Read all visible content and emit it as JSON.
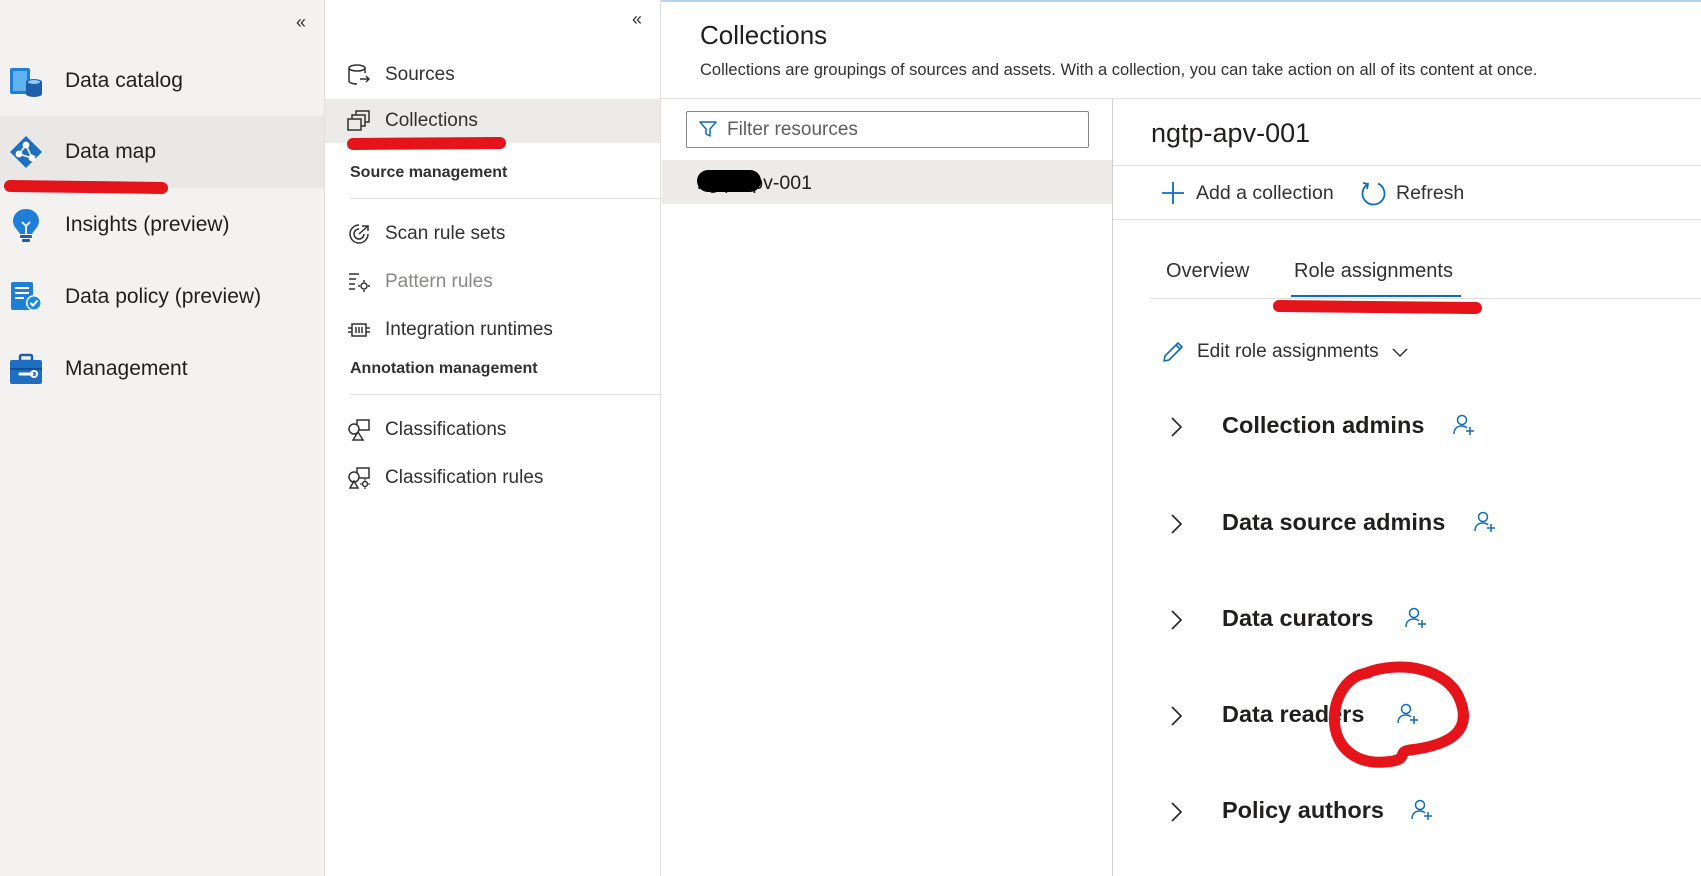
{
  "left_nav": {
    "collapse_glyph": "«",
    "items": [
      {
        "label": "Data catalog",
        "icon": "data-catalog-icon"
      },
      {
        "label": "Data map",
        "icon": "data-map-icon"
      },
      {
        "label": "Insights (preview)",
        "icon": "insights-bulb-icon"
      },
      {
        "label": "Data policy (preview)",
        "icon": "data-policy-icon"
      },
      {
        "label": "Management",
        "icon": "toolbox-icon"
      }
    ],
    "active_index": 1
  },
  "sub_nav": {
    "collapse_glyph": "«",
    "items": [
      {
        "label": "Sources",
        "icon": "sources-icon"
      },
      {
        "label": "Collections",
        "icon": "collections-icon"
      }
    ],
    "source_management": {
      "header": "Source management",
      "items": [
        {
          "label": "Scan rule sets",
          "icon": "scan-rule-sets-icon"
        },
        {
          "label": "Pattern rules",
          "icon": "pattern-rules-icon"
        },
        {
          "label": "Integration runtimes",
          "icon": "integration-runtimes-icon"
        }
      ]
    },
    "annotation_management": {
      "header": "Annotation management",
      "items": [
        {
          "label": "Classifications",
          "icon": "classifications-icon"
        },
        {
          "label": "Classification rules",
          "icon": "classification-rules-icon"
        }
      ]
    }
  },
  "main": {
    "title": "Collections",
    "description": "Collections are groupings of sources and assets. With a collection, you can take action on all of its content at once.",
    "filter_placeholder": "Filter resources",
    "collection_item": "ngtp-apv-001"
  },
  "detail": {
    "title": "ngtp-apv-001",
    "add_collection": "Add a collection",
    "refresh": "Refresh",
    "tabs": [
      "Overview",
      "Role assignments"
    ],
    "active_tab": 1,
    "edit_role_assignments": "Edit role assignments",
    "roles": [
      {
        "label": "Collection admins"
      },
      {
        "label": "Data source admins"
      },
      {
        "label": "Data curators"
      },
      {
        "label": "Data readers"
      },
      {
        "label": "Policy authors"
      }
    ]
  },
  "colors": {
    "accent": "#0f6cbd",
    "annotation_red": "#e5141b",
    "nav_background": "#f3f2f1"
  }
}
